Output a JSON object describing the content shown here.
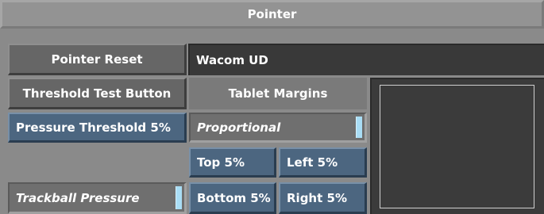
{
  "panel": {
    "title": "Pointer"
  },
  "buttons": {
    "pointer_reset": "Pointer Reset",
    "threshold_test": "Threshold Test Button",
    "pressure_threshold": "Pressure Threshold 5%"
  },
  "device": {
    "name": "Wacom UD"
  },
  "tablet_margins": {
    "label": "Tablet Margins",
    "mode": "Proportional",
    "top": "Top 5%",
    "left": "Left 5%",
    "bottom": "Bottom 5%",
    "right": "Right 5%"
  },
  "trackball": {
    "label": "Trackball Pressure"
  },
  "colors": {
    "accent_blue": "#4c6680",
    "slider_knob": "#a9ddf5",
    "panel_gray": "#8a8a8a"
  }
}
